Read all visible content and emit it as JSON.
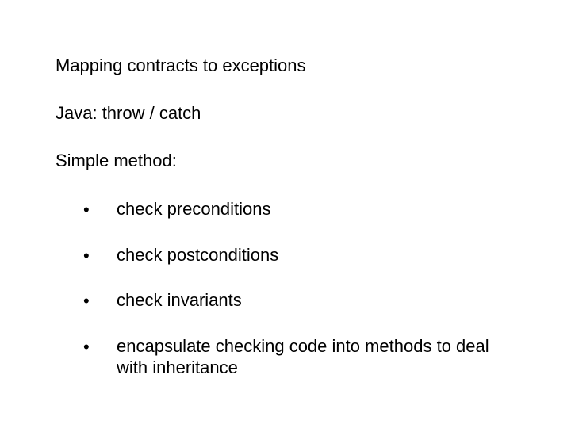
{
  "title": "Mapping contracts to exceptions",
  "line_java": "Java:  throw / catch",
  "line_simple": "Simple method:",
  "bullets": [
    "check preconditions",
    "check postconditions",
    "check invariants",
    "encapsulate checking code into methods to deal with inheritance"
  ]
}
